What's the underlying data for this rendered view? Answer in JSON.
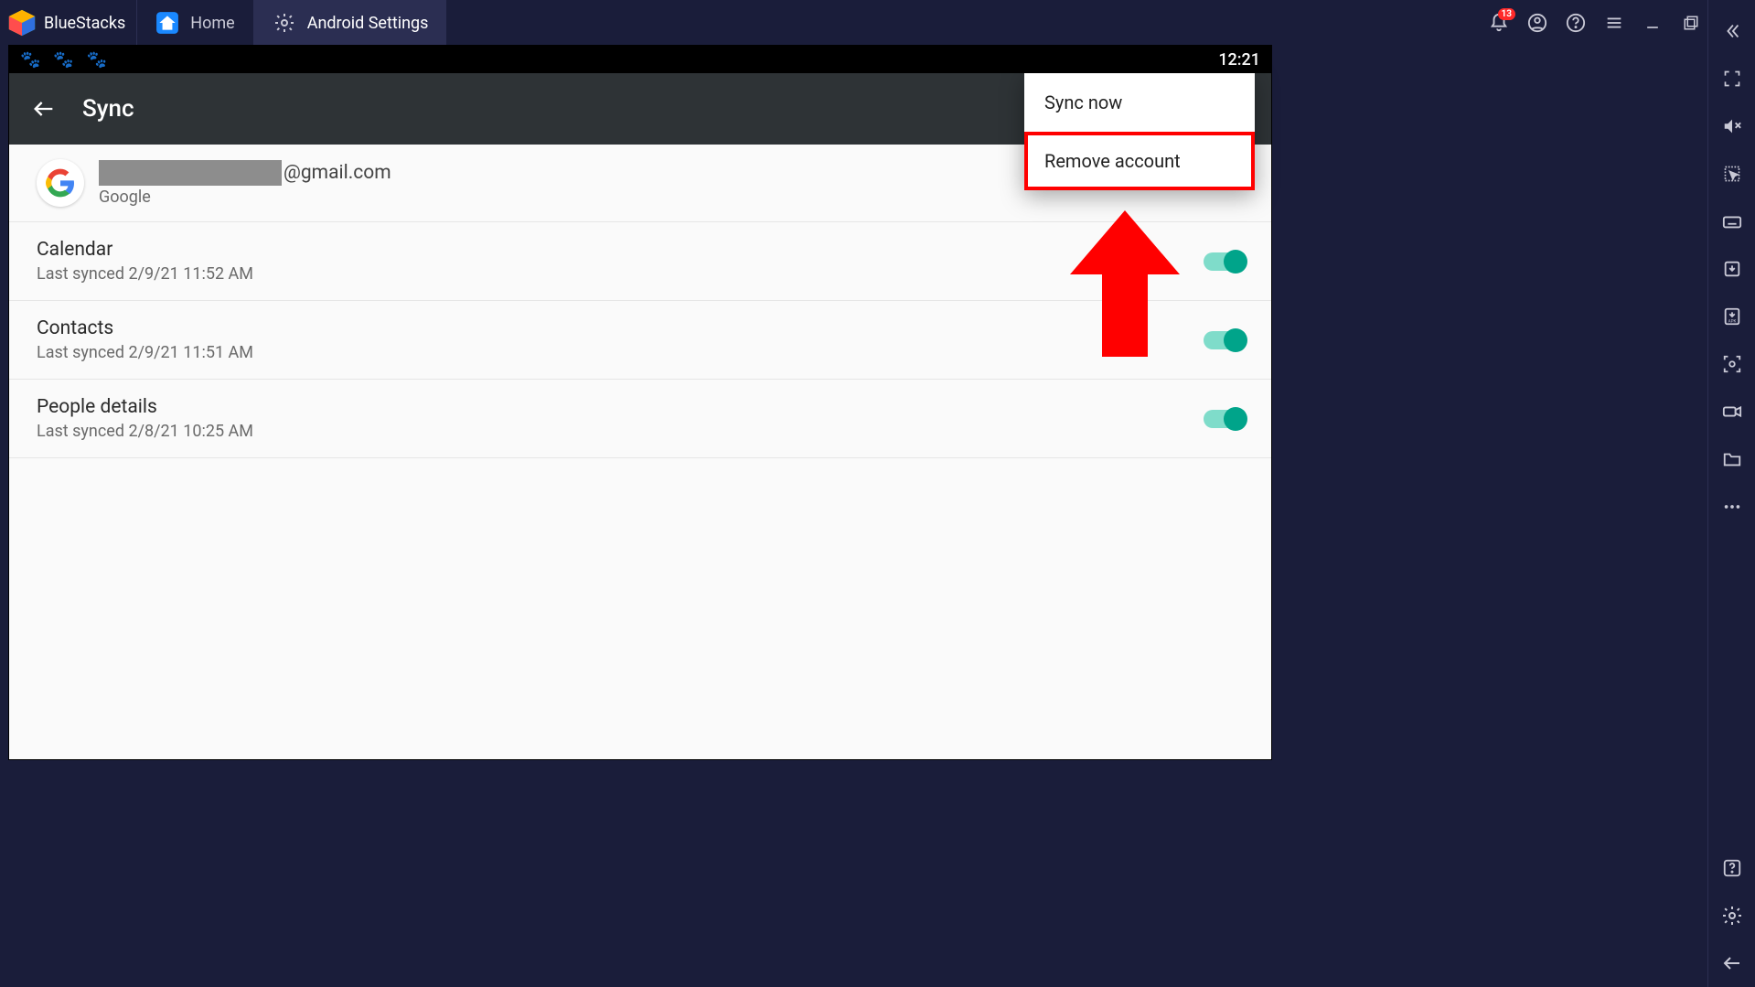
{
  "titlebar": {
    "brand": "BlueStacks",
    "notification_count": "13",
    "tabs": [
      {
        "label": "Home"
      },
      {
        "label": "Android Settings"
      }
    ]
  },
  "statusbar": {
    "time": "12:21"
  },
  "appbar": {
    "title": "Sync"
  },
  "account": {
    "email_suffix": "@gmail.com",
    "provider": "Google"
  },
  "sync_items": [
    {
      "title": "Calendar",
      "subtitle": "Last synced 2/9/21 11:52 AM"
    },
    {
      "title": "Contacts",
      "subtitle": "Last synced 2/9/21 11:51 AM"
    },
    {
      "title": "People details",
      "subtitle": "Last synced 2/8/21 10:25 AM"
    }
  ],
  "dropdown": {
    "sync_now": "Sync now",
    "remove_account": "Remove account"
  }
}
